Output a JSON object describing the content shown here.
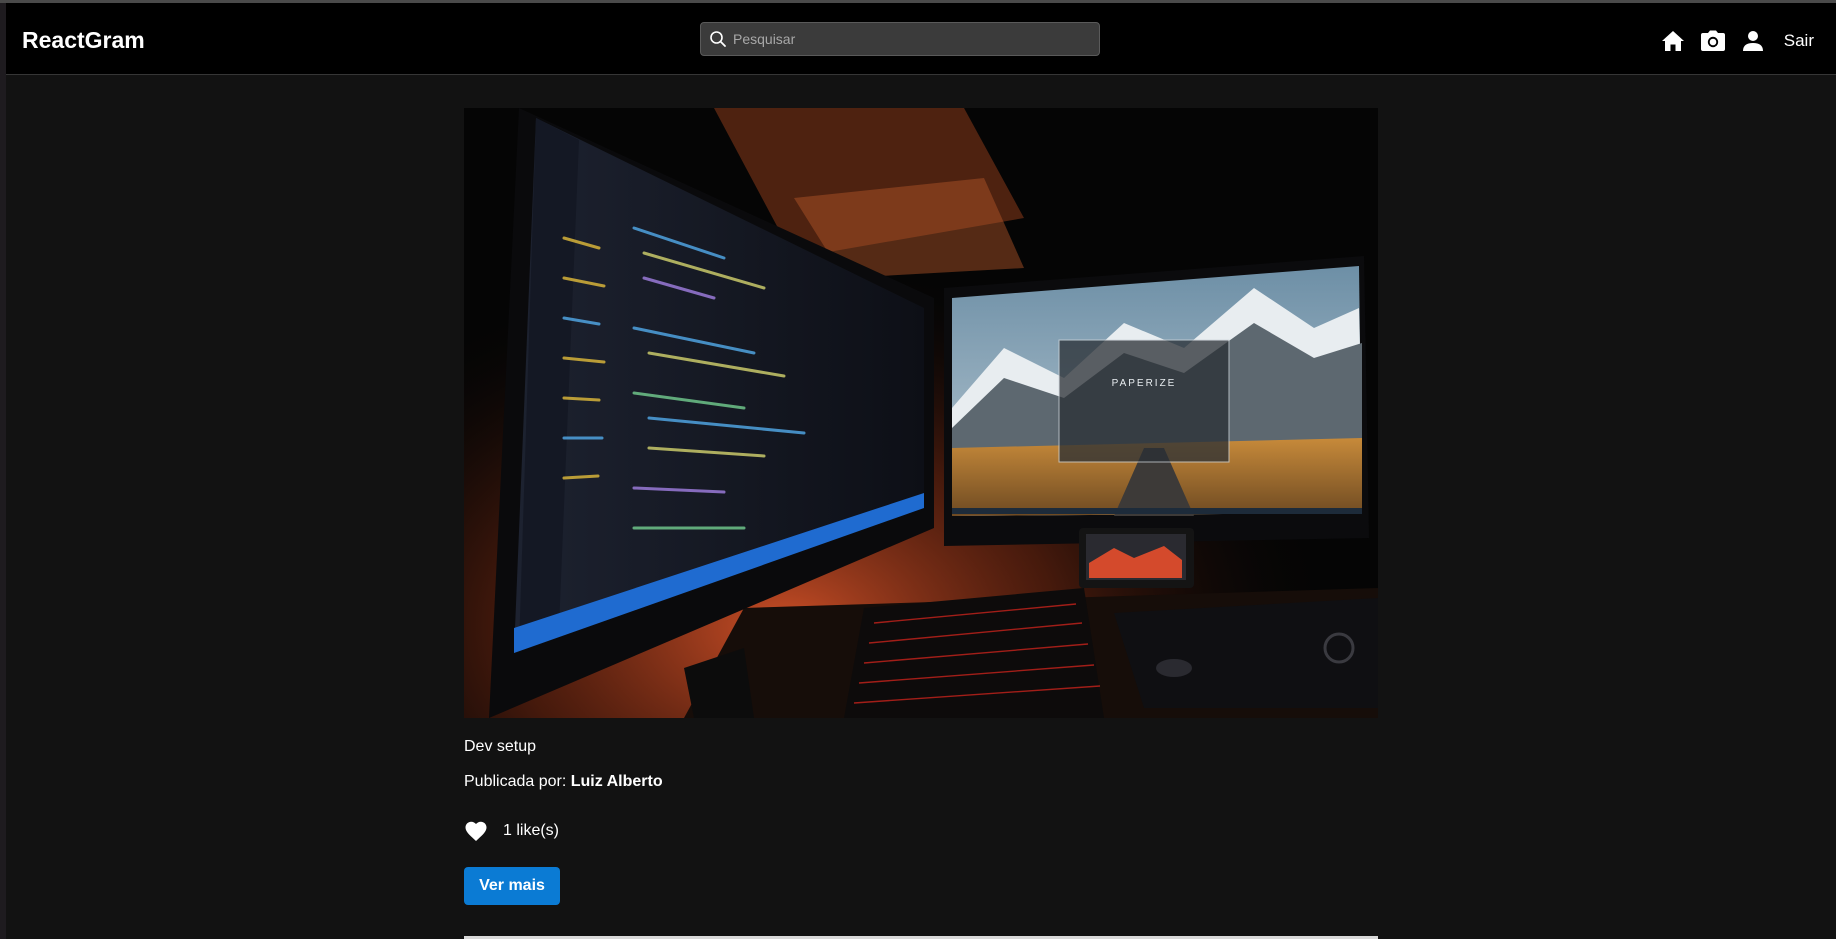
{
  "navbar": {
    "logo": "ReactGram",
    "search_placeholder": "Pesquisar",
    "search_value": "",
    "icons": [
      "search-icon",
      "home-icon",
      "camera-icon",
      "user-icon"
    ],
    "logout_label": "Sair"
  },
  "post": {
    "image_description_icon": "photo",
    "title": "Dev setup",
    "author_prefix": "Publicada por:",
    "author_name": "Luiz Alberto",
    "likes_text": "1 like(s)",
    "like_icon": "heart-icon",
    "more_button": "Ver mais",
    "screen_text": "PAPERIZE"
  },
  "colors": {
    "background": "#121212",
    "navbar": "#000000",
    "button": "#0b7bd4"
  }
}
